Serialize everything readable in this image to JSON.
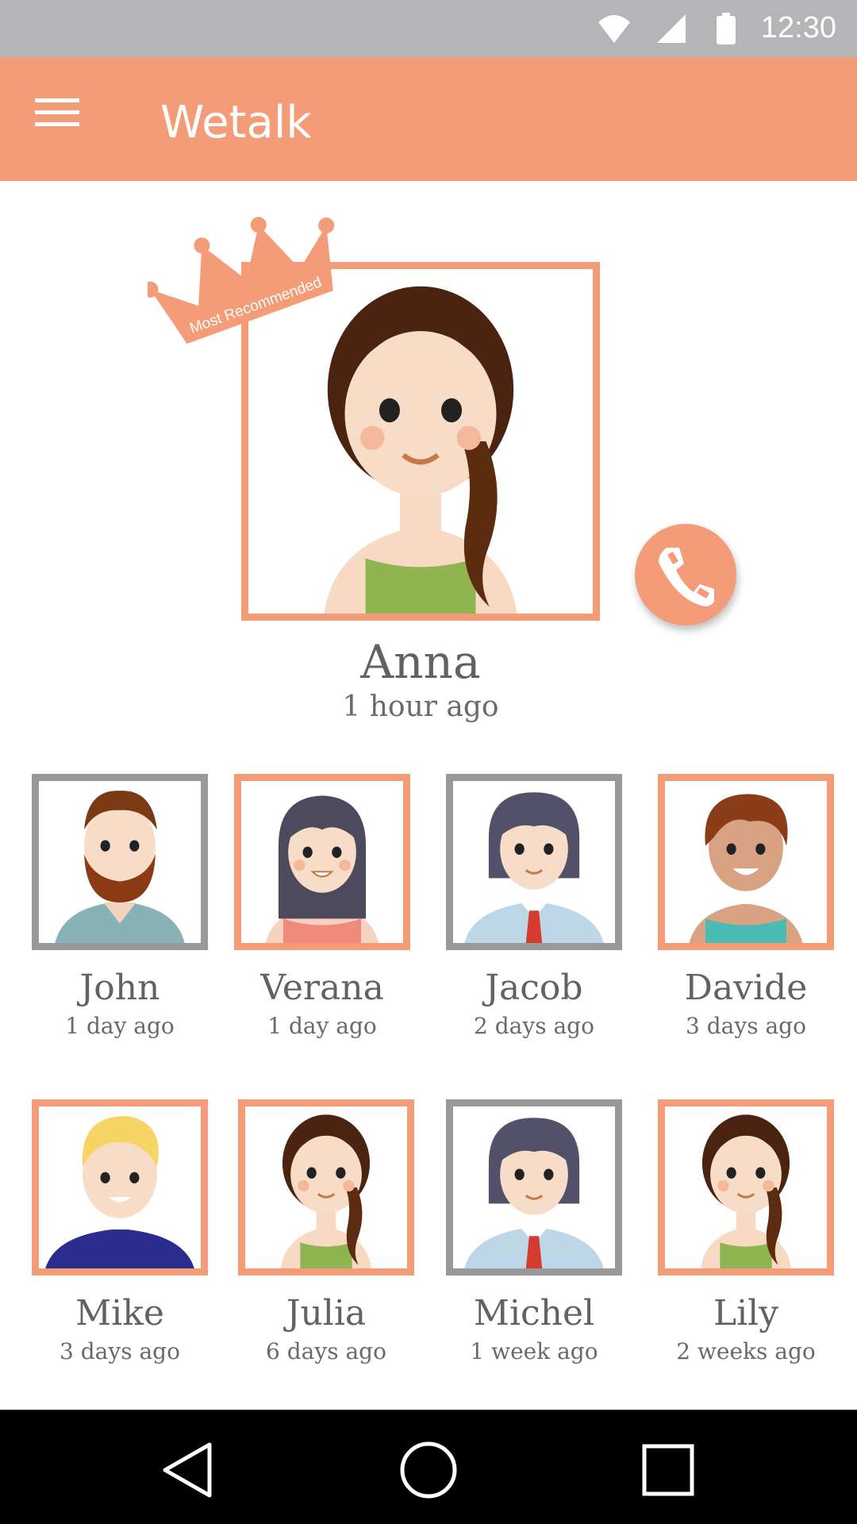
{
  "status_bar": {
    "time": "12:30",
    "icons": [
      "wifi-icon",
      "signal-icon",
      "battery-icon"
    ]
  },
  "app_bar": {
    "title": "Wetalk",
    "menu_icon": "menu-icon"
  },
  "featured": {
    "badge": "Most Recommended",
    "name": "Anna",
    "time": "1 hour ago",
    "call_icon": "phone-icon"
  },
  "contacts": [
    {
      "name": "John",
      "time": "1 day ago"
    },
    {
      "name": "Verana",
      "time": "1 day ago"
    },
    {
      "name": "Jacob",
      "time": "2 days ago"
    },
    {
      "name": "Davide",
      "time": "3 days ago"
    },
    {
      "name": "Mike",
      "time": "3 days ago"
    },
    {
      "name": "Julia",
      "time": "6 days ago"
    },
    {
      "name": "Michel",
      "time": "1 week ago"
    },
    {
      "name": "Lily",
      "time": "2 weeks ago"
    }
  ],
  "nav_bar": {
    "icons": [
      "back-icon",
      "home-icon",
      "recents-icon"
    ]
  },
  "colors": {
    "accent": "#f49b78",
    "frame_gray": "#999999",
    "text": "#626262",
    "status_bar": "#b5b4b6"
  }
}
